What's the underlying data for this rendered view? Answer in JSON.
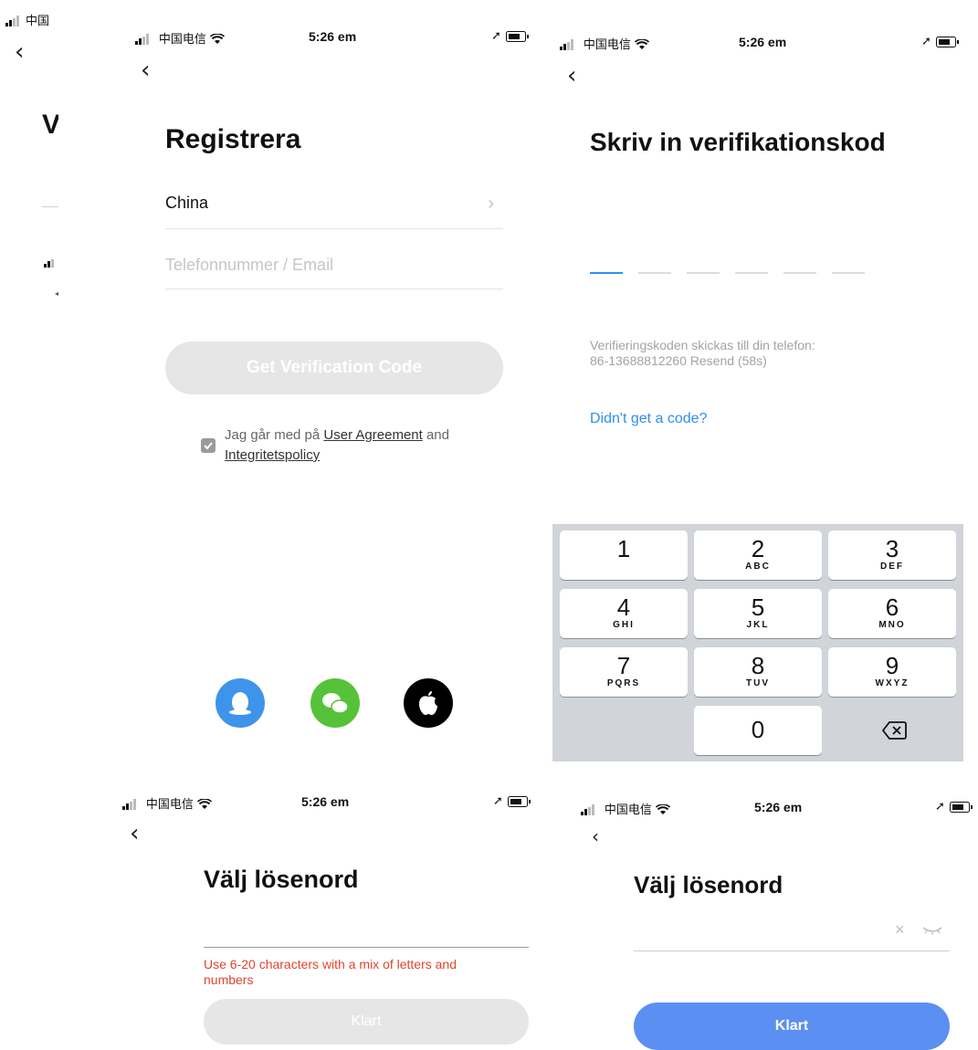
{
  "status_bar": {
    "carrier": "中国电信",
    "carrier_cut": "中国",
    "time": "5:26 em",
    "wifi_icon": "wifi-icon",
    "battery_icon": "battery-icon",
    "location_icon": "location-arrow-icon"
  },
  "edge_panel": {
    "title_fragment": "V"
  },
  "register": {
    "title": "Registrera",
    "country": "China",
    "phone_placeholder": "Telefonnummer / Email",
    "get_code_button": "Get Verification Code",
    "agreement_prefix": "Jag går med på",
    "user_agreement_link": "User Agreement",
    "agreement_and": "and",
    "privacy_link": "Integritetspolicy",
    "social": [
      "qq-icon",
      "wechat-icon",
      "apple-icon"
    ]
  },
  "verify": {
    "title": "Skriv in verifikationskod",
    "info_line1": "Verifieringskoden skickas till din telefon:",
    "info_line2": "86-13688812260  Resend (58s)",
    "no_code_link": "Didn't get a code?",
    "keypad": [
      {
        "num": "1",
        "letters": ""
      },
      {
        "num": "2",
        "letters": "ABC"
      },
      {
        "num": "3",
        "letters": "DEF"
      },
      {
        "num": "4",
        "letters": "GHI"
      },
      {
        "num": "5",
        "letters": "JKL"
      },
      {
        "num": "6",
        "letters": "MNO"
      },
      {
        "num": "7",
        "letters": "PQRS"
      },
      {
        "num": "8",
        "letters": "TUV"
      },
      {
        "num": "9",
        "letters": "WXYZ"
      },
      {
        "num": "0",
        "letters": ""
      }
    ]
  },
  "password_a": {
    "title": "Välj lösenord",
    "hint": "Use 6-20 characters with a mix of letters and numbers",
    "done_button": "Klart"
  },
  "password_b": {
    "title": "Välj lösenord",
    "done_button": "Klart"
  },
  "colors": {
    "accent_blue": "#2f8ff0",
    "button_blue": "#5b8ff2",
    "button_disabled": "#e6e6e6",
    "error_red": "#e0452c",
    "keypad_bg": "#d1d4d9",
    "qq_blue": "#3d94ea",
    "wechat_green": "#56c23a"
  }
}
